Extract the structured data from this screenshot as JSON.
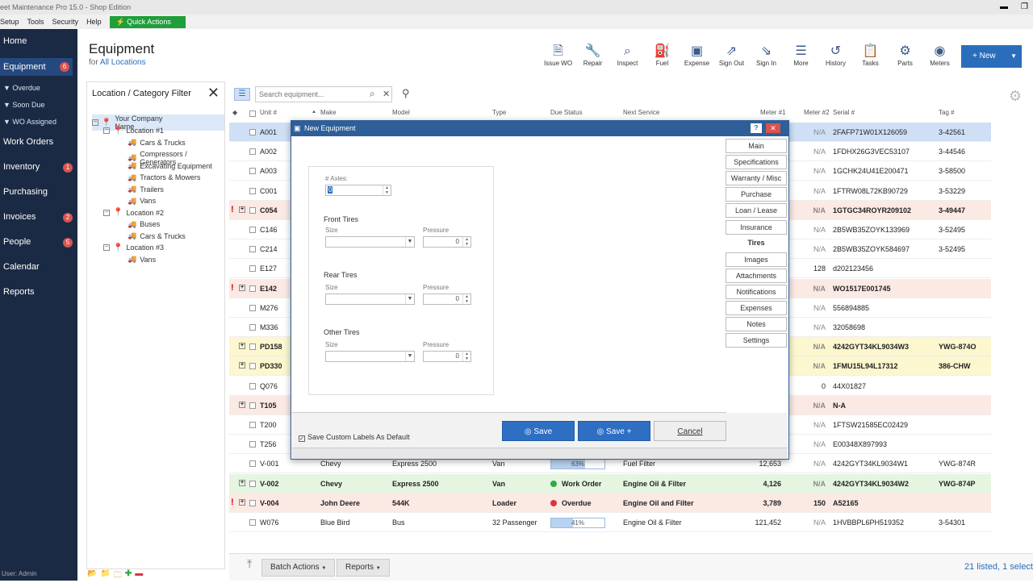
{
  "app": {
    "title": "eet Maintenance Pro 15.0 - Shop Edition",
    "minimize": "▬",
    "restore": "❐"
  },
  "menu": [
    "Setup",
    "Tools",
    "Security",
    "Help"
  ],
  "quick_actions": "Quick Actions",
  "sidebar": {
    "items": [
      {
        "label": "Home"
      },
      {
        "label": "Equipment",
        "badge": "6"
      },
      {
        "label": "Work Orders"
      },
      {
        "label": "Inventory",
        "badge": "1"
      },
      {
        "label": "Purchasing"
      },
      {
        "label": "Invoices",
        "badge": "2"
      },
      {
        "label": "People",
        "badge": "5"
      },
      {
        "label": "Calendar"
      },
      {
        "label": "Reports"
      }
    ],
    "subitems": [
      "Overdue",
      "Soon Due",
      "WO Assigned"
    ],
    "user": "User: Admin"
  },
  "header": {
    "title": "Equipment",
    "for": "for",
    "location": "All Locations"
  },
  "toolbar": [
    "Issue WO",
    "Repair",
    "Inspect",
    "Fuel",
    "Expense",
    "Sign Out",
    "Sign In",
    "More",
    "History",
    "Tasks",
    "Parts",
    "Meters"
  ],
  "new_button": "+ New",
  "filter": {
    "title": "Location / Category Filter",
    "tree": [
      {
        "label": "Your Company Name",
        "level": 0
      },
      {
        "label": "Location #1",
        "level": 1
      },
      {
        "label": "Cars & Trucks",
        "level": 2
      },
      {
        "label": "Compressors / Generators",
        "level": 2
      },
      {
        "label": "Excavating Equipment",
        "level": 2
      },
      {
        "label": "Tractors & Mowers",
        "level": 2
      },
      {
        "label": "Trailers",
        "level": 2
      },
      {
        "label": "Vans",
        "level": 2
      },
      {
        "label": "Location #2",
        "level": 1
      },
      {
        "label": "Buses",
        "level": 2
      },
      {
        "label": "Cars & Trucks",
        "level": 2
      },
      {
        "label": "Location #3",
        "level": 1
      },
      {
        "label": "Vans",
        "level": 2
      }
    ]
  },
  "search": {
    "placeholder": "Search equipment..."
  },
  "columns": [
    "Unit #",
    "Make",
    "Model",
    "Type",
    "Due Status",
    "Next Service",
    "Meter #1",
    "Meter #2",
    "Serial #",
    "Tag #"
  ],
  "rows": [
    {
      "unit": "A001",
      "m2": "N/A",
      "serial": "2FAFP71W01X126059",
      "tag": "3-42561",
      "bg": "#cfe0f6"
    },
    {
      "unit": "A002",
      "m2": "N/A",
      "serial": "1FDHX26G3VEC53107",
      "tag": "3-44546",
      "bg": "#ffffff"
    },
    {
      "unit": "A003",
      "m2": "N/A",
      "serial": "1GCHK24U41E200471",
      "tag": "3-58500",
      "bg": "#ffffff"
    },
    {
      "unit": "C001",
      "m2": "N/A",
      "serial": "1FTRW08L72KB90729",
      "tag": "3-53229",
      "bg": "#ffffff"
    },
    {
      "unit": "C054",
      "m2": "N/A",
      "serial": "1GTGC34ROYR209102",
      "tag": "3-49447",
      "bg": "#fbe9e4",
      "bold": true,
      "flag": true,
      "expand": true
    },
    {
      "unit": "C146",
      "m2": "N/A",
      "serial": "2B5WB35ZOYK133969",
      "tag": "3-52495",
      "bg": "#ffffff"
    },
    {
      "unit": "C214",
      "m2": "N/A",
      "serial": "2B5WB35ZOYK584697",
      "tag": "3-52495",
      "bg": "#ffffff"
    },
    {
      "unit": "E127",
      "m2": "128",
      "serial": "d202123456",
      "tag": "",
      "bg": "#ffffff"
    },
    {
      "unit": "E142",
      "m2": "N/A",
      "serial": "WO1517E001745",
      "tag": "",
      "bg": "#fbe9e4",
      "bold": true,
      "flag": true,
      "expand": true
    },
    {
      "unit": "M276",
      "m2": "N/A",
      "serial": "556894885",
      "tag": "",
      "bg": "#ffffff"
    },
    {
      "unit": "M336",
      "m2": "N/A",
      "serial": "32058698",
      "tag": "",
      "bg": "#ffffff"
    },
    {
      "unit": "PD158",
      "m2": "N/A",
      "serial": "4242GYT34KL9034W3",
      "tag": "YWG-874O",
      "bg": "#fdf7cf",
      "bold": true,
      "expand": true
    },
    {
      "unit": "PD330",
      "m2": "N/A",
      "serial": "1FMU15L94L17312",
      "tag": "386-CHW",
      "bg": "#fdf7cf",
      "bold": true,
      "expand": true
    },
    {
      "unit": "Q076",
      "m2": "0",
      "serial": "44X01827",
      "tag": "",
      "bg": "#ffffff"
    },
    {
      "unit": "T105",
      "m2": "N/A",
      "serial": "N-A",
      "tag": "",
      "bg": "#fbe9e4",
      "bold": true,
      "expand": true
    },
    {
      "unit": "T200",
      "m2": "N/A",
      "serial": "1FTSW21585EC02429",
      "tag": "",
      "bg": "#ffffff"
    },
    {
      "unit": "T256",
      "m2": "N/A",
      "serial": "E00348X897993",
      "tag": "",
      "bg": "#ffffff"
    },
    {
      "unit": "V-001",
      "make": "Chevy",
      "model": "Express 2500",
      "type": "Van",
      "due_bar": "63%",
      "due_frac": 0.63,
      "next": "Fuel Filter",
      "m1": "12,653",
      "m2": "N/A",
      "serial": "4242GYT34KL9034W1",
      "tag": "YWG-874R",
      "bg": "#ffffff"
    },
    {
      "unit": "V-002",
      "make": "Chevy",
      "model": "Express 2500",
      "type": "Van",
      "due_text": "Work Order",
      "due_color": "#2faa47",
      "next": "Engine Oil & Filter",
      "m1": "4,126",
      "m2": "N/A",
      "serial": "4242GYT34KL9034W2",
      "tag": "YWG-874P",
      "bg": "#e5f5e0",
      "bold": true,
      "expand": true
    },
    {
      "unit": "V-004",
      "make": "John Deere",
      "model": "544K",
      "type": "Loader",
      "due_text": "Overdue",
      "due_color": "#d9363e",
      "next": "Engine Oil and Filter",
      "m1": "3,789",
      "m2": "150",
      "serial": "A52165",
      "tag": "",
      "bg": "#fbe9e4",
      "bold": true,
      "flag": true,
      "expand": true
    },
    {
      "unit": "W076",
      "make": "Blue Bird",
      "model": "Bus",
      "type": "32 Passenger",
      "due_bar": "41%",
      "due_frac": 0.41,
      "next": "Engine Oil & Filter",
      "m1": "121,452",
      "m2": "N/A",
      "serial": "1HVBBPL6PH519352",
      "tag": "3-54301",
      "bg": "#ffffff"
    }
  ],
  "bottom": {
    "batch": "Batch Actions",
    "reports": "Reports",
    "status": "21 listed, 1 select"
  },
  "dialog": {
    "title": "New Equipment",
    "help": "?",
    "close": "✕",
    "axles_label": "# Axles:",
    "axles_value": "0",
    "front_title": "Front Tires",
    "rear_title": "Rear Tires",
    "other_title": "Other Tires",
    "size_label": "Size",
    "pressure_label": "Pressure",
    "pressure_value": "0",
    "tabs": [
      "Main",
      "Specifications",
      "Warranty / Misc",
      "Purchase",
      "Loan / Lease",
      "Insurance",
      "Tires",
      "Images",
      "Attachments",
      "Notifications",
      "Expenses",
      "Notes",
      "Settings"
    ],
    "active_tab": "Tires",
    "save_defaults": "Save Custom Labels As Default",
    "save": "Save",
    "save_plus": "Save +",
    "cancel": "Cancel"
  },
  "colors": {
    "sidebar": "#1b2a44",
    "accent": "#2a6ebb",
    "dialog_title": "#2e5f99",
    "quick": "#1f9e3a"
  }
}
